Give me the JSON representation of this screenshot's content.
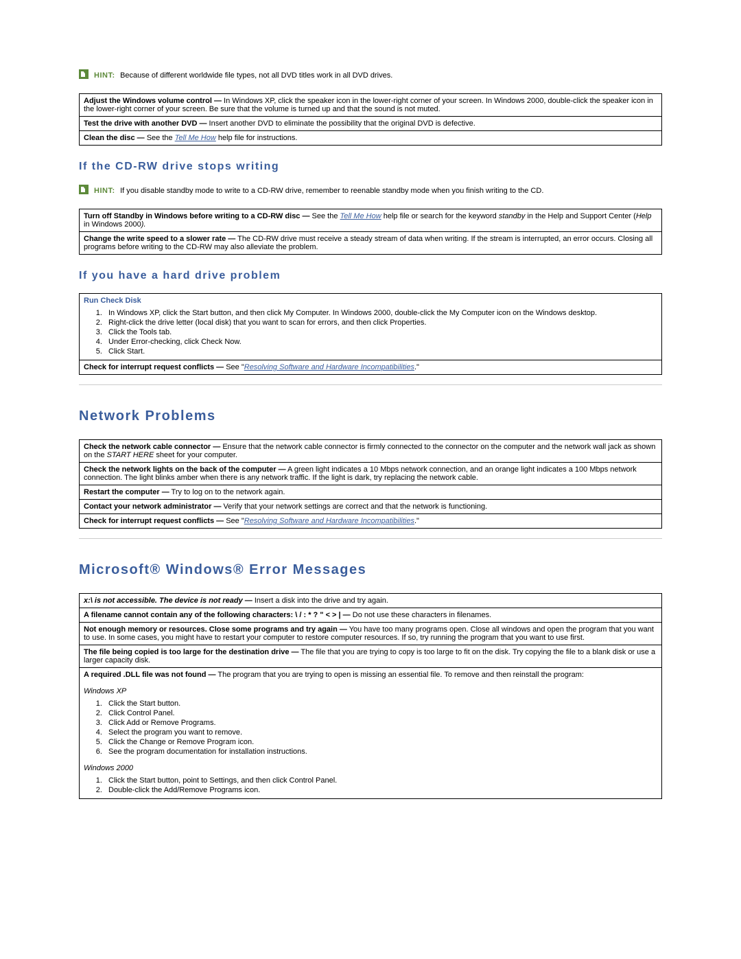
{
  "hint1_label": "HINT:",
  "hint1_text": "Because of different worldwide file types, not all DVD titles work in all DVD drives.",
  "t1r1_b": "Adjust the Windows volume control —",
  "t1r1_t": " In Windows XP, click the speaker icon in the lower-right corner of your screen. In Windows 2000, double-click the speaker icon in the lower-right corner of your screen. Be sure that the volume is turned up and that the sound is not muted.",
  "t1r2_b": "Test the drive with another DVD —",
  "t1r2_t": " Insert another DVD to eliminate the possibility that the original DVD is defective.",
  "t1r3_b": "Clean the disc —",
  "t1r3_t1": " See the ",
  "t1r3_link": "Tell Me How",
  "t1r3_t2": " help file for instructions.",
  "h_cdrw": "If the CD-RW drive stops writing",
  "hint2_label": "HINT:",
  "hint2_text": "If you disable standby mode to write to a CD-RW drive, remember to reenable standby mode when you finish writing to the CD.",
  "t2r1_b": "Turn off Standby in Windows before writing to a CD-RW disc —",
  "t2r1_t1": " See the ",
  "t2r1_link": "Tell Me How",
  "t2r1_t2": " help file or search for the keyword ",
  "t2r1_i": "standby",
  "t2r1_t3": " in the Help and Support Center (",
  "t2r1_i2": "Help",
  "t2r1_t4": " in Windows 2000",
  "t2r1_t5": ").",
  "t2r2_b": "Change the write speed to a slower rate —",
  "t2r2_t": " The CD-RW drive must receive a steady stream of data when writing. If the stream is interrupted, an error occurs. Closing all programs before writing to the CD-RW may also alleviate the problem.",
  "h_hd": "If you have a hard drive problem",
  "t3_head": "Run Check Disk",
  "t3_s1": "In Windows XP, click the Start button, and then click My Computer. In Windows 2000, double-click the My Computer icon on the Windows desktop.",
  "t3_s2": "Right-click the drive letter (local disk) that you want to scan for errors, and then click Properties.",
  "t3_s3": "Click the Tools tab.",
  "t3_s4": "Under Error-checking, click Check Now.",
  "t3_s5": "Click Start.",
  "t3r2_b": "Check for interrupt request conflicts —",
  "t3r2_t1": " See \"",
  "t3r2_link": "Resolving Software and Hardware Incompatibilities",
  "t3r2_t2": ".\"",
  "h_net": "Network Problems",
  "t4r1_b": "Check the network cable connector —",
  "t4r1_t": " Ensure that the network cable connector is firmly connected to the connector on the computer and the network wall jack as shown on the ",
  "t4r1_i": "START HERE",
  "t4r1_t2": " sheet for your computer.",
  "t4r2_b": "Check the network lights on the back of the computer —",
  "t4r2_t": " A green light indicates a 10 Mbps network connection, and an orange light indicates a 100 Mbps network connection. The light blinks amber when there is any network traffic. If the light is dark, try replacing the network cable.",
  "t4r3_b": "Restart the computer —",
  "t4r3_t": " Try to log on to the network again.",
  "t4r4_b": "Contact your network administrator —",
  "t4r4_t": " Verify that your network settings are correct and that the network is functioning.",
  "t4r5_b": "Check for interrupt request conflicts —",
  "t4r5_t1": " See \"",
  "t4r5_link": "Resolving Software and Hardware Incompatibilities",
  "t4r5_t2": ".\"",
  "h_err": "Microsoft® Windows® Error Messages",
  "t5r1_bi": "x:\\ is not accessible. The device is not ready —",
  "t5r1_t": " Insert a disk into the drive and try again.",
  "t5r2_b": "A filename cannot contain any of the following characters: \\ / : * ? \" < > | —",
  "t5r2_t": " Do not use these characters in filenames.",
  "t5r3_b": "Not enough memory or resources. Close some programs and try again —",
  "t5r3_t": " You have too many programs open. Close all windows and open the program that you want to use. In some cases, you might have to restart your computer to restore computer resources. If so, try running the program that you want to use first.",
  "t5r4_b": "The file being copied is too large for the destination drive —",
  "t5r4_t": " The file that you are trying to copy is too large to fit on the disk. Try copying the file to a blank disk or use a larger capacity disk.",
  "t5r5_b": "A required .DLL file was not found —",
  "t5r5_t": " The program that you are trying to open is missing an essential file. To remove and then reinstall the program:",
  "os_xp": "Windows XP",
  "xp_s1": "Click the Start button.",
  "xp_s2": "Click Control Panel.",
  "xp_s3": "Click Add or Remove Programs.",
  "xp_s4": "Select the program you want to remove.",
  "xp_s5": "Click the Change or Remove Program icon.",
  "xp_s6": "See the program documentation for installation instructions.",
  "os_2000": "Windows 2000",
  "w2_s1": "Click the Start button, point to Settings, and then click Control Panel.",
  "w2_s2": "Double-click the Add/Remove Programs icon."
}
